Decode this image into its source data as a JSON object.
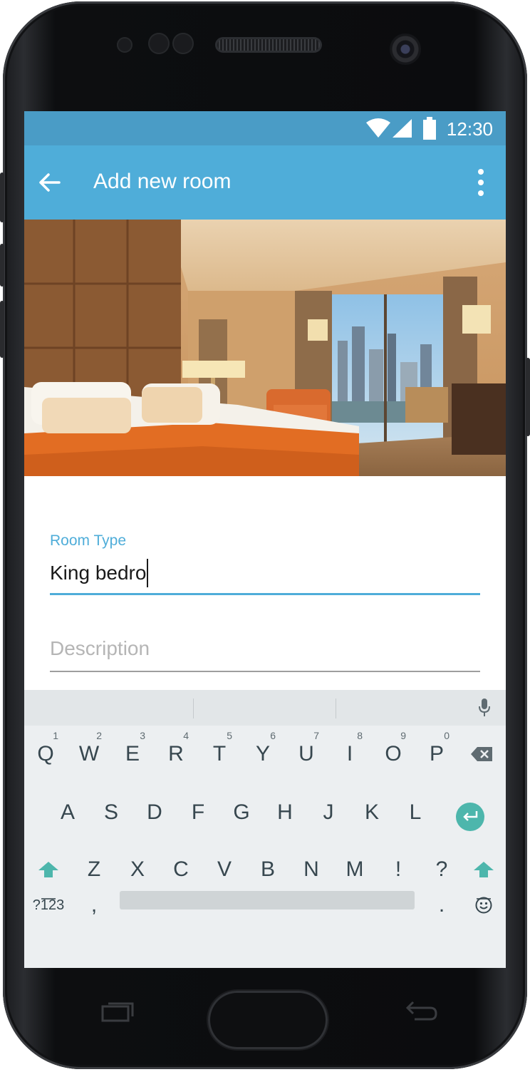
{
  "status_bar": {
    "time": "12:30",
    "icons": [
      "wifi-icon",
      "signal-icon",
      "battery-icon"
    ],
    "color": "#4a9cc6"
  },
  "app_bar": {
    "title": "Add new room",
    "back_icon": "arrow-back-icon",
    "menu_icon": "more-vert-icon",
    "color": "#4fadd9"
  },
  "hero_image": {
    "subject": "hotel-room-photo"
  },
  "form": {
    "room_type": {
      "label": "Room Type",
      "value": "King bedro"
    },
    "description": {
      "placeholder": "Description",
      "value": ""
    },
    "accent": "#4fadd9"
  },
  "keyboard": {
    "row1": [
      {
        "key": "Q",
        "hint": "1"
      },
      {
        "key": "W",
        "hint": "2"
      },
      {
        "key": "E",
        "hint": "3"
      },
      {
        "key": "R",
        "hint": "4"
      },
      {
        "key": "T",
        "hint": "5"
      },
      {
        "key": "Y",
        "hint": "6"
      },
      {
        "key": "U",
        "hint": "7"
      },
      {
        "key": "I",
        "hint": "8"
      },
      {
        "key": "O",
        "hint": "9"
      },
      {
        "key": "P",
        "hint": "0"
      }
    ],
    "row2": [
      "A",
      "S",
      "D",
      "F",
      "G",
      "H",
      "J",
      "K",
      "L"
    ],
    "row3": [
      "Z",
      "X",
      "C",
      "V",
      "B",
      "N",
      "M",
      "!",
      "?"
    ],
    "symbols_key": "?123",
    "comma_key": ",",
    "period_key": ".",
    "enter_color": "#4db6ac",
    "shift_color": "#4db6ac"
  }
}
